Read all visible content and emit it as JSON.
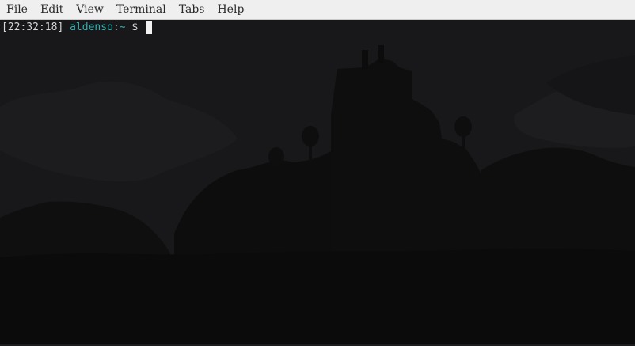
{
  "menubar": {
    "items": [
      {
        "label": "File"
      },
      {
        "label": "Edit"
      },
      {
        "label": "View"
      },
      {
        "label": "Terminal"
      },
      {
        "label": "Tabs"
      },
      {
        "label": "Help"
      }
    ]
  },
  "terminal": {
    "prompt": {
      "timestamp": "[22:32:18]",
      "user": "aldenso",
      "colon": ":",
      "path": "~",
      "symbol": "$"
    },
    "colors": {
      "background": "#111113",
      "prompt_accent": "#2bb3b3",
      "text": "#d6d6d6"
    }
  }
}
